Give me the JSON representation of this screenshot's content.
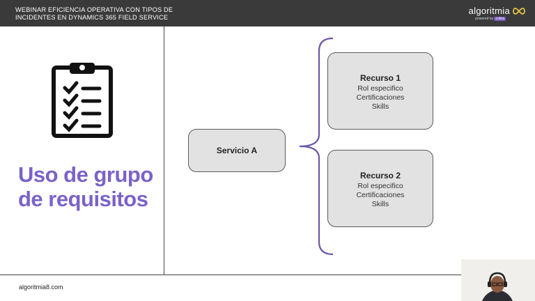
{
  "header": {
    "title_line1": "WEBINAR EFICIENCIA OPERATIVA CON TIPOS DE",
    "title_line2": "INCIDENTES EN DYNAMICS 365 FIELD SERVICE",
    "logo_text": "algoritmia",
    "logo_sub": "powered by",
    "logo_badge": "cobra"
  },
  "left": {
    "icon": "clipboard-checklist-icon",
    "headline_line1": "Uso de grupo",
    "headline_line2": "de requisitos"
  },
  "diagram": {
    "service": {
      "title": "Servicio A"
    },
    "resources": [
      {
        "title": "Recurso 1",
        "lines": [
          "Rol especifico",
          "Certificaciones",
          "Skills"
        ]
      },
      {
        "title": "Recurso 2",
        "lines": [
          "Rol especifico",
          "Certificaciones",
          "Skills"
        ]
      }
    ]
  },
  "footer": {
    "url": "algoritmia8.com"
  },
  "colors": {
    "topbar": "#3a3a3a",
    "accent": "#7b62c9",
    "brace": "#6b56a8",
    "box_fill": "#e2e2e2"
  }
}
